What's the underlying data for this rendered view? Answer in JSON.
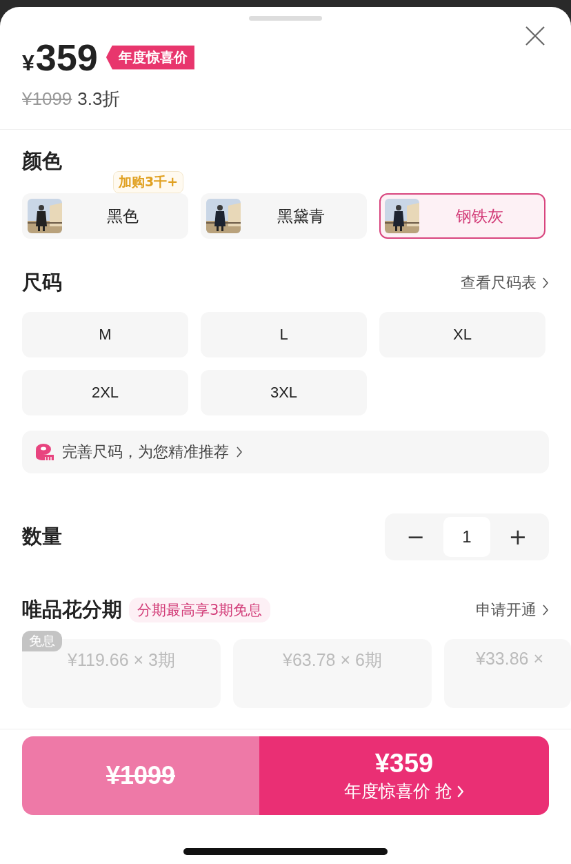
{
  "price": {
    "current_symbol": "¥",
    "current": "359",
    "tag": "年度惊喜价",
    "original": "¥1099",
    "discount": "3.3折"
  },
  "color_section": {
    "title": "颜色",
    "options": [
      {
        "label": "黑色",
        "selected": false,
        "badge": "加购3千+"
      },
      {
        "label": "黑黛青",
        "selected": false
      },
      {
        "label": "钢铁灰",
        "selected": true
      }
    ]
  },
  "size_section": {
    "title": "尺码",
    "link": "查看尺码表",
    "options": [
      {
        "label": "M",
        "selected": false
      },
      {
        "label": "L",
        "selected": false
      },
      {
        "label": "XL",
        "selected": false
      },
      {
        "label": "2XL",
        "selected": false
      },
      {
        "label": "3XL",
        "selected": false
      }
    ],
    "recommend": "完善尺码，为您精准推荐"
  },
  "quantity": {
    "title": "数量",
    "minus": "−",
    "value": "1",
    "plus": "+"
  },
  "installments": {
    "title": "唯品花分期",
    "tag": "分期最高享3期免息",
    "link": "申请开通",
    "plans": [
      {
        "text": "¥119.66 × 3期",
        "badge": "免息"
      },
      {
        "text": "¥63.78 × 6期"
      },
      {
        "text": "¥33.86 ×"
      }
    ]
  },
  "footer": {
    "original_price": "¥1099",
    "buy_price": "¥359",
    "buy_label": "年度惊喜价 抢"
  }
}
